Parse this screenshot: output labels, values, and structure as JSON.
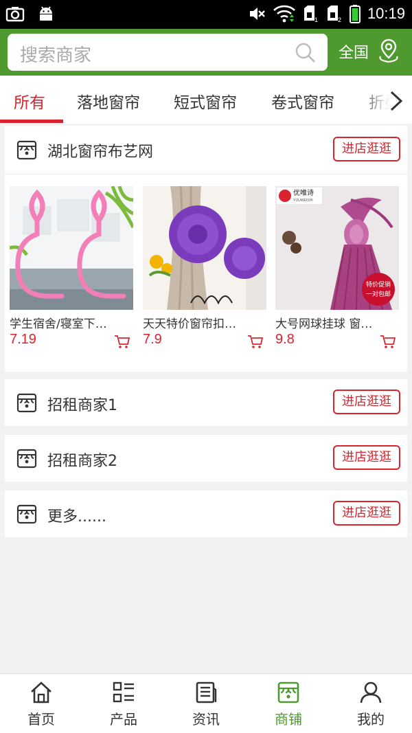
{
  "status_bar": {
    "time": "10:19"
  },
  "search": {
    "placeholder": "搜索商家",
    "region": "全国"
  },
  "tabs": [
    {
      "label": "所有",
      "active": true
    },
    {
      "label": "落地窗帘"
    },
    {
      "label": "短式窗帘"
    },
    {
      "label": "卷式窗帘"
    },
    {
      "label": "折叠"
    }
  ],
  "shops": [
    {
      "name": "湖北窗帘布艺网",
      "button": "进店逛逛",
      "products": [
        {
          "name": "学生宿舍/寝室下…",
          "price": "7.19"
        },
        {
          "name": "天天特价窗帘扣…",
          "price": "7.9"
        },
        {
          "name": "大号网球挂球 窗…",
          "price": "9.8",
          "brand": "优唯诗",
          "brand_sub": "YOUWEISHI",
          "promo_1": "特价促销",
          "promo_2": "一对包邮"
        }
      ]
    },
    {
      "name": "招租商家1",
      "button": "进店逛逛"
    },
    {
      "name": "招租商家2",
      "button": "进店逛逛"
    },
    {
      "name": "更多......",
      "button": "进店逛逛"
    }
  ],
  "bottom_nav": [
    {
      "label": "首页",
      "icon": "home-icon"
    },
    {
      "label": "产品",
      "icon": "list-icon"
    },
    {
      "label": "资讯",
      "icon": "news-icon"
    },
    {
      "label": "商铺",
      "icon": "shop-icon",
      "active": true
    },
    {
      "label": "我的",
      "icon": "user-icon"
    }
  ],
  "colors": {
    "accent_green": "#4e9a2f",
    "accent_red": "#d9232d"
  }
}
